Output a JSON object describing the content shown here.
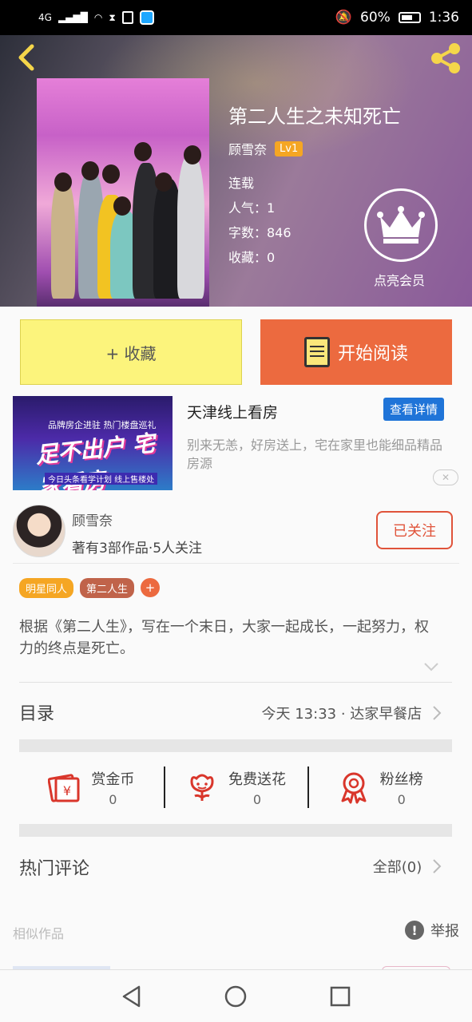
{
  "status_bar": {
    "network": "4G",
    "battery_percent": "60%",
    "time": "1:36"
  },
  "book": {
    "title": "第二人生之未知死亡",
    "author": "顾雪奈",
    "level": "Lv1",
    "status": "连载",
    "popularity": "人气：1",
    "word_count": "字数：846",
    "favorites": "收藏：0",
    "vip_label": "点亮会员"
  },
  "actions": {
    "collect": "+ 收藏",
    "read": "开始阅读"
  },
  "ad": {
    "image_line1": "品牌房企进驻 热门楼盘巡礼",
    "image_line2": "足不出户 宅家看房",
    "image_line3": "今日头条看学计划 线上售楼处",
    "title": "天津线上看房",
    "button": "查看详情",
    "description": "别来无恙，好房送上，宅在家里也能细品精品房源",
    "close": "✕"
  },
  "author_card": {
    "name": "顾雪奈",
    "stats": "著有3部作品·5人关注",
    "follow_state": "已关注"
  },
  "tags": [
    {
      "label": "明星同人",
      "color": "#f5a623"
    },
    {
      "label": "第二人生",
      "color": "#c0634a"
    },
    {
      "label": "+",
      "color": "#ec6a3f"
    }
  ],
  "intro": "根据《第二人生》，写在一个末日，大家一起成长，一起努力，权力的终点是死亡。",
  "catalog": {
    "label": "目录",
    "latest": "今天 13:33 · 达家早餐店"
  },
  "stats": [
    {
      "label": "赏金币",
      "value": "0",
      "icon": "reward-coin-icon"
    },
    {
      "label": "免费送花",
      "value": "0",
      "icon": "flower-icon"
    },
    {
      "label": "粉丝榜",
      "value": "0",
      "icon": "medal-icon"
    }
  ],
  "comments": {
    "label": "热门评论",
    "all": "全部(0)"
  },
  "similar": {
    "label": "相似作品",
    "report": "举报"
  },
  "colors": {
    "accent_orange": "#ec6a3f",
    "collect_yellow": "#fcf47c",
    "icon_red": "#d9362b",
    "back_yellow": "#f5d64a"
  }
}
